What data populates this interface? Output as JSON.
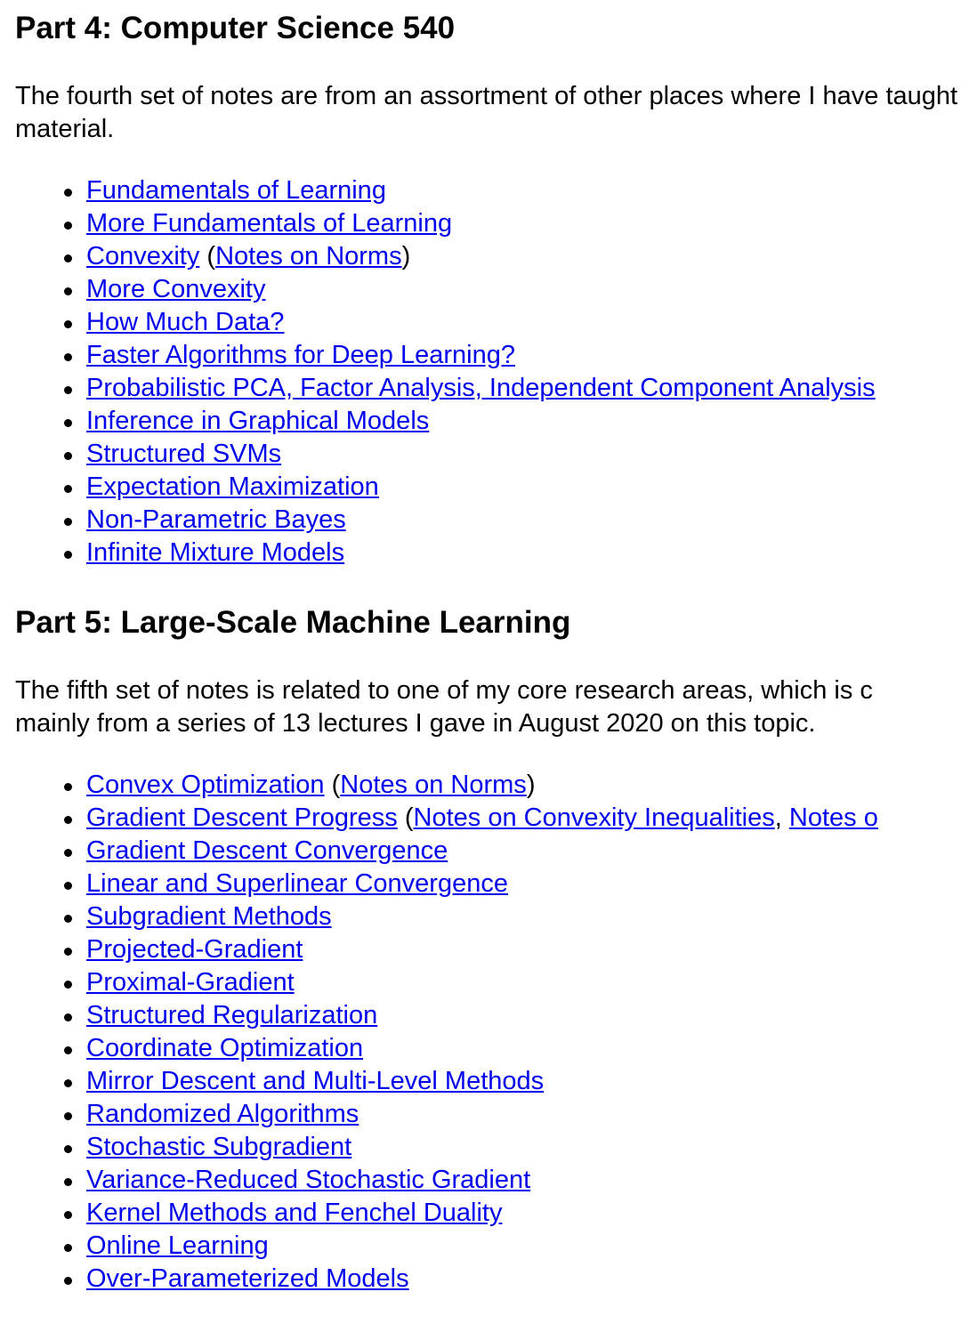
{
  "part4": {
    "heading": "Part 4: Computer Science 540",
    "intro_line1": "The fourth set of notes are from an assortment of other places where I have taught this",
    "intro_line2": "material.",
    "items": [
      {
        "links": [
          "Fundamentals of Learning"
        ]
      },
      {
        "links": [
          "More Fundamentals of Learning"
        ]
      },
      {
        "links": [
          "Convexity",
          "Notes on Norms"
        ]
      },
      {
        "links": [
          "More Convexity"
        ]
      },
      {
        "links": [
          "How Much Data?"
        ]
      },
      {
        "links": [
          "Faster Algorithms for Deep Learning?"
        ]
      },
      {
        "links": [
          "Probabilistic PCA, Factor Analysis, Independent Component Analysis"
        ]
      },
      {
        "links": [
          "Inference in Graphical Models"
        ]
      },
      {
        "links": [
          "Structured SVMs"
        ]
      },
      {
        "links": [
          "Expectation Maximization"
        ]
      },
      {
        "links": [
          "Non-Parametric Bayes"
        ]
      },
      {
        "links": [
          "Infinite Mixture Models"
        ]
      }
    ]
  },
  "part5": {
    "heading": "Part 5: Large-Scale Machine Learning",
    "intro_line1": "The fifth set of notes is related to one of my core research areas, which is c",
    "intro_line2": "mainly from a series of 13 lectures I gave in August 2020 on this topic.",
    "items": [
      {
        "links": [
          "Convex Optimization",
          "Notes on Norms"
        ]
      },
      {
        "links": [
          "Gradient Descent Progress",
          "Notes on Convexity Inequalities",
          "Notes o"
        ]
      },
      {
        "links": [
          "Gradient Descent Convergence"
        ]
      },
      {
        "links": [
          "Linear and Superlinear Convergence"
        ]
      },
      {
        "links": [
          "Subgradient Methods"
        ]
      },
      {
        "links": [
          "Projected-Gradient"
        ]
      },
      {
        "links": [
          "Proximal-Gradient"
        ]
      },
      {
        "links": [
          "Structured Regularization"
        ]
      },
      {
        "links": [
          "Coordinate Optimization"
        ]
      },
      {
        "links": [
          "Mirror Descent and Multi-Level Methods"
        ]
      },
      {
        "links": [
          "Randomized Algorithms"
        ]
      },
      {
        "links": [
          "Stochastic Subgradient"
        ]
      },
      {
        "links": [
          "Variance-Reduced Stochastic Gradient"
        ]
      },
      {
        "links": [
          "Kernel Methods and Fenchel Duality"
        ]
      },
      {
        "links": [
          "Online Learning"
        ]
      },
      {
        "links": [
          "Over-Parameterized Models"
        ]
      }
    ]
  },
  "punctuation": {
    "open": "(",
    "close": ")",
    "comma": ", "
  },
  "colors": {
    "link": "#0000ee",
    "text": "#000000",
    "background": "#ffffff"
  }
}
